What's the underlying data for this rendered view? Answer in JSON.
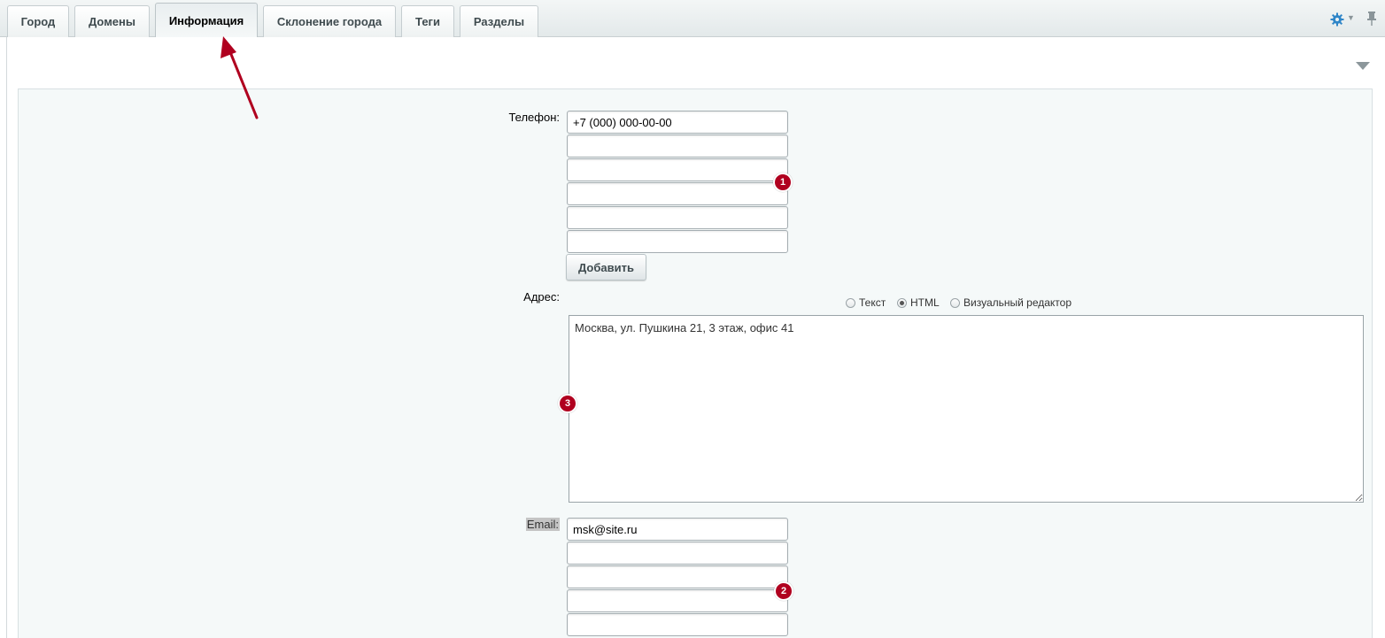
{
  "tabs": [
    {
      "label": "Город",
      "active": false
    },
    {
      "label": "Домены",
      "active": false
    },
    {
      "label": "Информация",
      "active": true
    },
    {
      "label": "Склонение города",
      "active": false
    },
    {
      "label": "Теги",
      "active": false
    },
    {
      "label": "Разделы",
      "active": false
    }
  ],
  "toolbar": {
    "settings_icon": "gear-icon",
    "pin_icon": "pin-icon"
  },
  "form": {
    "phone": {
      "label": "Телефон:",
      "values": [
        "+7 (000) 000-00-00",
        "",
        "",
        "",
        "",
        ""
      ],
      "add_button": "Добавить",
      "badge": "1"
    },
    "address": {
      "label": "Адрес:",
      "editor_modes": [
        {
          "label": "Текст",
          "checked": false
        },
        {
          "label": "HTML",
          "checked": true
        },
        {
          "label": "Визуальный редактор",
          "checked": false
        }
      ],
      "value": "Москва, ул. Пушкина 21, 3 этаж, офис 41",
      "badge": "3"
    },
    "email": {
      "label": "Email:",
      "values": [
        "msk@site.ru",
        "",
        "",
        "",
        ""
      ],
      "badge": "2"
    }
  },
  "colors": {
    "accent": "#2f86c8",
    "badge": "#b0001f",
    "annotation_arrow": "#b0001f"
  }
}
